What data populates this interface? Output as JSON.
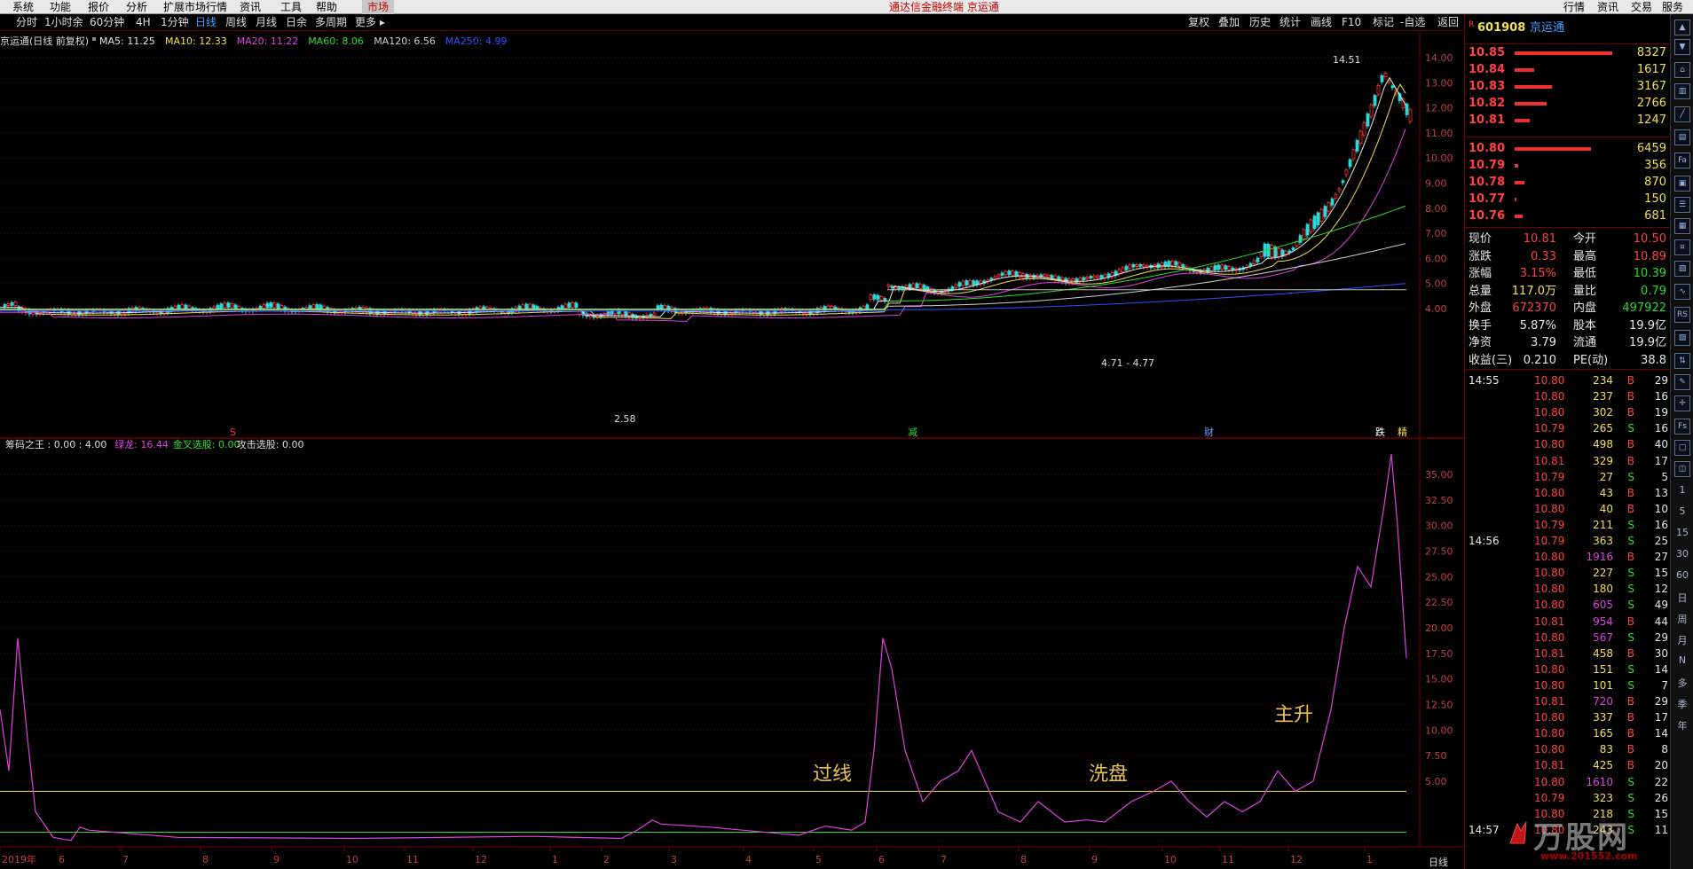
{
  "menu": {
    "items": [
      "系统",
      "功能",
      "报价",
      "分析",
      "扩展市场行情",
      "资讯",
      "工具",
      "帮助"
    ],
    "market": "市场",
    "title": "通达信金融终端  京运通",
    "right": [
      "行情",
      "资讯",
      "交易",
      "服务"
    ]
  },
  "periods": [
    "分时",
    "1小时余",
    "60分钟",
    "4H",
    "1分钟",
    "日线",
    "周线",
    "月线",
    "日余",
    "多周期",
    "更多 ▸"
  ],
  "active_period": "日线",
  "toolbar_right": [
    "复权",
    "叠加",
    "历史",
    "统计",
    "画线",
    "F10",
    "标记",
    "-自选",
    "返回"
  ],
  "main_chart": {
    "label": "京运通(日线 前复权)",
    "ma": [
      {
        "text": "MA5: 11.25",
        "color": "#e6e6e6"
      },
      {
        "text": "MA10: 12.33",
        "color": "#f0e050"
      },
      {
        "text": "MA20: 11.22",
        "color": "#e040e0"
      },
      {
        "text": "MA60: 8.06",
        "color": "#2bdc2b"
      },
      {
        "text": "MA120: 6.56",
        "color": "#d0d0d0"
      },
      {
        "text": "MA250: 4.99",
        "color": "#3050ff"
      }
    ],
    "y_ticks": [
      "14.00",
      "13.00",
      "12.00",
      "11.00",
      "10.00",
      "9.00",
      "8.00",
      "7.00",
      "6.00",
      "5.00",
      "4.00"
    ],
    "annotations": {
      "high": "14.51",
      "low": "2.58",
      "range": "4.71 - 4.77"
    },
    "event_marks": [
      "S",
      "减",
      "财",
      "跌",
      "精"
    ]
  },
  "indicator": {
    "name": "筹码之王",
    "values": [
      {
        "text": "筹码之王 : 0.00 : 4.00",
        "color": "#dcdcdc"
      },
      {
        "text": "绿龙: 16.44",
        "color": "#e040e0"
      },
      {
        "text": "金叉选股: 0.00",
        "color": "#2bdc2b"
      },
      {
        "text": "攻击选股: 0.00",
        "color": "#dcdcdc"
      }
    ],
    "y_ticks": [
      "35.00",
      "32.50",
      "30.00",
      "27.50",
      "25.00",
      "22.50",
      "20.00",
      "17.50",
      "15.00",
      "12.50",
      "10.00",
      "7.50",
      "5.00"
    ],
    "annotations": [
      "过线",
      "洗盘",
      "主升"
    ]
  },
  "x_labels": [
    "2019年",
    "6",
    "7",
    "8",
    "9",
    "10",
    "11",
    "12",
    "1",
    "2",
    "3",
    "4",
    "5",
    "6",
    "7",
    "8",
    "9",
    "10",
    "11",
    "12",
    "1"
  ],
  "x_period_label": "日线",
  "stock": {
    "code": "601908",
    "name": "京运通"
  },
  "asks": [
    {
      "price": "10.85",
      "vol": "8327",
      "bar": 1.0
    },
    {
      "price": "10.84",
      "vol": "1617",
      "bar": 0.2
    },
    {
      "price": "10.83",
      "vol": "3167",
      "bar": 0.38
    },
    {
      "price": "10.82",
      "vol": "2766",
      "bar": 0.33
    },
    {
      "price": "10.81",
      "vol": "1247",
      "bar": 0.15
    }
  ],
  "bids": [
    {
      "price": "10.80",
      "vol": "6459",
      "bar": 0.78
    },
    {
      "price": "10.79",
      "vol": "356",
      "bar": 0.04
    },
    {
      "price": "10.78",
      "vol": "870",
      "bar": 0.1
    },
    {
      "price": "10.77",
      "vol": "150",
      "bar": 0.02
    },
    {
      "price": "10.76",
      "vol": "681",
      "bar": 0.08
    }
  ],
  "quote": [
    {
      "l1": "现价",
      "v1": "10.81",
      "c1": "red",
      "l2": "今开",
      "v2": "10.50",
      "c2": "red"
    },
    {
      "l1": "涨跌",
      "v1": "0.33",
      "c1": "red",
      "l2": "最高",
      "v2": "10.89",
      "c2": "red"
    },
    {
      "l1": "涨幅",
      "v1": "3.15%",
      "c1": "red",
      "l2": "最低",
      "v2": "10.39",
      "c2": "green"
    },
    {
      "l1": "总量",
      "v1": "117.0万",
      "c1": "yellow",
      "l2": "量比",
      "v2": "0.79",
      "c2": "green"
    },
    {
      "l1": "外盘",
      "v1": "672370",
      "c1": "red",
      "l2": "内盘",
      "v2": "497922",
      "c2": "green"
    },
    {
      "l1": "换手",
      "v1": "5.87%",
      "c1": "white",
      "l2": "股本",
      "v2": "19.9亿",
      "c2": "white"
    },
    {
      "l1": "净资",
      "v1": "3.79",
      "c1": "white",
      "l2": "流通",
      "v2": "19.9亿",
      "c2": "white"
    },
    {
      "l1": "收益(三)",
      "v1": "0.210",
      "c1": "white",
      "l2": "PE(动)",
      "v2": "38.8",
      "c2": "white"
    }
  ],
  "ticks": [
    {
      "time": "14:55",
      "price": "10.80",
      "vol": "234",
      "bs": "B",
      "n": "29"
    },
    {
      "time": "",
      "price": "10.80",
      "vol": "237",
      "bs": "B",
      "n": "16"
    },
    {
      "time": "",
      "price": "10.80",
      "vol": "302",
      "bs": "B",
      "n": "19"
    },
    {
      "time": "",
      "price": "10.79",
      "vol": "265",
      "bs": "S",
      "n": "16"
    },
    {
      "time": "",
      "price": "10.80",
      "vol": "498",
      "bs": "B",
      "n": "40"
    },
    {
      "time": "",
      "price": "10.81",
      "vol": "329",
      "bs": "B",
      "n": "17"
    },
    {
      "time": "",
      "price": "10.79",
      "vol": "27",
      "bs": "S",
      "n": "5"
    },
    {
      "time": "",
      "price": "10.80",
      "vol": "43",
      "bs": "B",
      "n": "13"
    },
    {
      "time": "",
      "price": "10.80",
      "vol": "40",
      "bs": "B",
      "n": "10"
    },
    {
      "time": "",
      "price": "10.79",
      "vol": "211",
      "bs": "S",
      "n": "16"
    },
    {
      "time": "14:56",
      "price": "10.79",
      "vol": "363",
      "bs": "S",
      "n": "25"
    },
    {
      "time": "",
      "price": "10.80",
      "vol": "1916",
      "bs": "B",
      "n": "27"
    },
    {
      "time": "",
      "price": "10.80",
      "vol": "227",
      "bs": "S",
      "n": "15"
    },
    {
      "time": "",
      "price": "10.80",
      "vol": "180",
      "bs": "S",
      "n": "12"
    },
    {
      "time": "",
      "price": "10.80",
      "vol": "605",
      "bs": "S",
      "n": "49"
    },
    {
      "time": "",
      "price": "10.81",
      "vol": "954",
      "bs": "B",
      "n": "44"
    },
    {
      "time": "",
      "price": "10.80",
      "vol": "567",
      "bs": "S",
      "n": "29"
    },
    {
      "time": "",
      "price": "10.81",
      "vol": "458",
      "bs": "B",
      "n": "30"
    },
    {
      "time": "",
      "price": "10.80",
      "vol": "151",
      "bs": "S",
      "n": "14"
    },
    {
      "time": "",
      "price": "10.80",
      "vol": "101",
      "bs": "S",
      "n": "7"
    },
    {
      "time": "",
      "price": "10.81",
      "vol": "720",
      "bs": "B",
      "n": "29"
    },
    {
      "time": "",
      "price": "10.80",
      "vol": "337",
      "bs": "B",
      "n": "17"
    },
    {
      "time": "",
      "price": "10.80",
      "vol": "165",
      "bs": "B",
      "n": "14"
    },
    {
      "time": "",
      "price": "10.80",
      "vol": "83",
      "bs": "B",
      "n": "8"
    },
    {
      "time": "",
      "price": "10.81",
      "vol": "425",
      "bs": "B",
      "n": "20"
    },
    {
      "time": "",
      "price": "10.80",
      "vol": "1610",
      "bs": "S",
      "n": "22"
    },
    {
      "time": "",
      "price": "10.79",
      "vol": "323",
      "bs": "S",
      "n": "26"
    },
    {
      "time": "",
      "price": "10.80",
      "vol": "218",
      "bs": "S",
      "n": "15"
    },
    {
      "time": "14:57",
      "price": "10.80",
      "vol": "243",
      "bs": "S",
      "n": "11"
    }
  ],
  "tool_labels": [
    "1",
    "5",
    "15",
    "30",
    "60",
    "日",
    "周",
    "月",
    "N",
    "多",
    "季",
    "年"
  ],
  "logo": {
    "text": "万股网",
    "url": "www.201552.com"
  }
}
